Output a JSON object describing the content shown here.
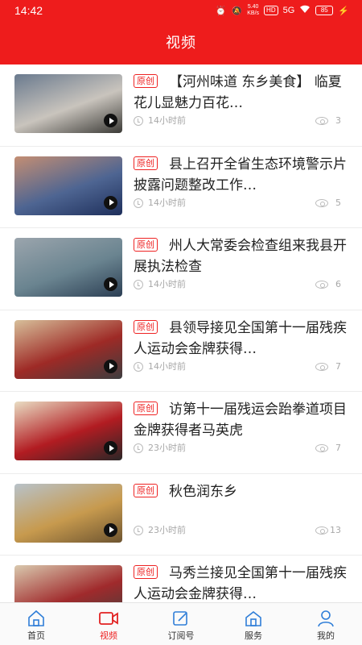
{
  "status_bar": {
    "time": "14:42",
    "speed_value": "5.40",
    "speed_unit": "KB/s",
    "hd_badge": "HD",
    "network": "5G",
    "battery": "85",
    "icons": [
      "alarm-icon",
      "mute-icon",
      "wifi-icon",
      "battery-icon",
      "charging-icon"
    ]
  },
  "header": {
    "title": "视频"
  },
  "badge_label": "原创",
  "articles": [
    {
      "title": "【河州味道 东乡美食】 临夏花儿显魅力百花…",
      "time": "14小时前",
      "views": "3",
      "thumb_colors": [
        "#6a7a8e",
        "#c9c4bd",
        "#3b3a36"
      ]
    },
    {
      "title": "县上召开全省生态环境警示片披露问题整改工作…",
      "time": "14小时前",
      "views": "5",
      "thumb_colors": [
        "#c48e73",
        "#4e6592",
        "#1e2f5b"
      ]
    },
    {
      "title": "州人大常委会检查组来我县开展执法检查",
      "time": "14小时前",
      "views": "6",
      "thumb_colors": [
        "#9ba5ad",
        "#6a8490",
        "#2c3f54"
      ]
    },
    {
      "title": "县领导接见全国第十一届残疾人运动会金牌获得…",
      "time": "14小时前",
      "views": "7",
      "thumb_colors": [
        "#d7bf9a",
        "#9e2a26",
        "#3c3d3f"
      ]
    },
    {
      "title": "访第十一届残运会跆拳道项目金牌获得者马英虎",
      "time": "23小时前",
      "views": "7",
      "thumb_colors": [
        "#e9ddc3",
        "#b21c22",
        "#2a2626"
      ]
    },
    {
      "title": "秋色润东乡",
      "time": "23小时前",
      "views": "13",
      "thumb_colors": [
        "#b8c2c9",
        "#c79a4e",
        "#6d5430"
      ]
    },
    {
      "title": "马秀兰接见全国第十一届残疾人运动会金牌获得…",
      "time": "",
      "views": "",
      "thumb_colors": [
        "#d9c9ae",
        "#a02a2c",
        "#403e3b"
      ]
    }
  ],
  "tabbar": {
    "active_color": "#2f7ed8",
    "tabs": [
      {
        "label": "首页",
        "icon": "home-icon",
        "active": false
      },
      {
        "label": "视频",
        "icon": "video-icon",
        "active": true
      },
      {
        "label": "订阅号",
        "icon": "subscribe-icon",
        "active": false
      },
      {
        "label": "服务",
        "icon": "service-icon",
        "active": false
      },
      {
        "label": "我的",
        "icon": "user-icon",
        "active": false
      }
    ]
  }
}
